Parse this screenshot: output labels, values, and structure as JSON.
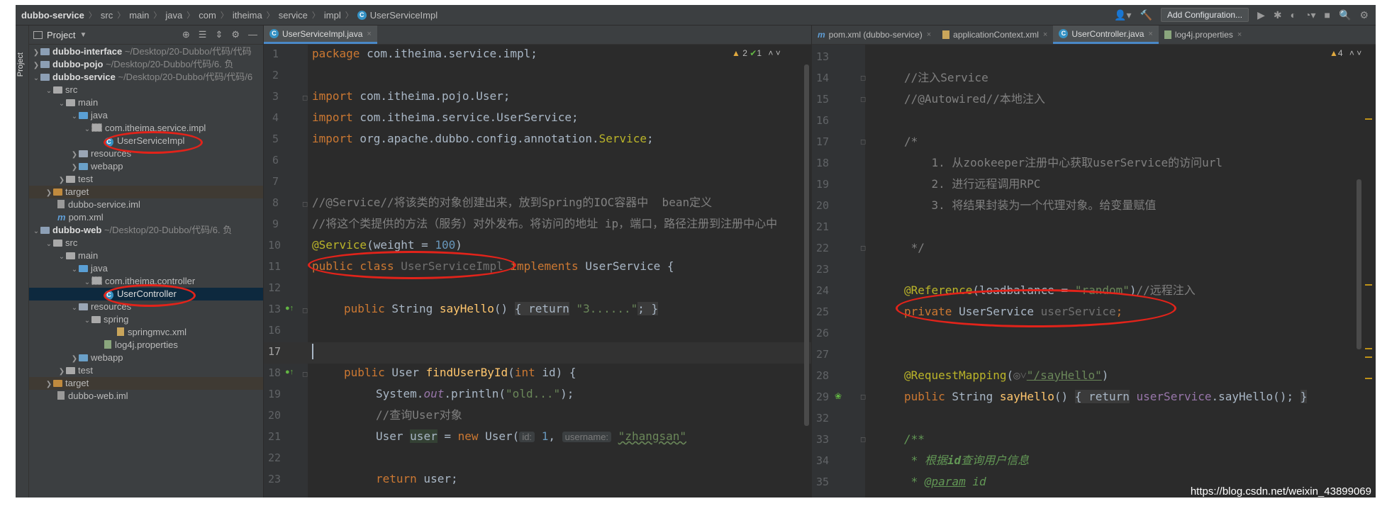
{
  "navbar": {
    "crumbs": [
      "dubbo-service",
      "src",
      "main",
      "java",
      "com",
      "itheima",
      "service",
      "impl"
    ],
    "current_file": "UserServiceImpl",
    "add_config_label": "Add Configuration..."
  },
  "sidebar": {
    "strip_label": "Project"
  },
  "project": {
    "title": "Project",
    "rows": [
      {
        "name": "dubbo-interface",
        "path": " ~/Desktop/20-Dubbo/代码/代码"
      },
      {
        "name": "dubbo-pojo",
        "path": " ~/Desktop/20-Dubbo/代码/6. 负"
      },
      {
        "name": "dubbo-service",
        "path": " ~/Desktop/20-Dubbo/代码/代码/6"
      },
      {
        "name": "src"
      },
      {
        "name": "main"
      },
      {
        "name": "java"
      },
      {
        "name": "com.itheima.service.impl"
      },
      {
        "name": "UserServiceImpl"
      },
      {
        "name": "resources"
      },
      {
        "name": "webapp"
      },
      {
        "name": "test"
      },
      {
        "name": "target"
      },
      {
        "name": "dubbo-service.iml"
      },
      {
        "name": "pom.xml"
      },
      {
        "name": "dubbo-web",
        "path": " ~/Desktop/20-Dubbo/代码/6. 负"
      },
      {
        "name": "src"
      },
      {
        "name": "main"
      },
      {
        "name": "java"
      },
      {
        "name": "com.itheima.controller"
      },
      {
        "name": "UserController"
      },
      {
        "name": "resources"
      },
      {
        "name": "spring"
      },
      {
        "name": "springmvc.xml"
      },
      {
        "name": "log4j.properties"
      },
      {
        "name": "webapp"
      },
      {
        "name": "test"
      },
      {
        "name": "target"
      },
      {
        "name": "dubbo-web.iml"
      }
    ]
  },
  "left_editor": {
    "tab": "UserServiceImpl.java",
    "inspections": {
      "warnings": "2",
      "ok": "1"
    },
    "line_numbers": [
      "1",
      "2",
      "3",
      "4",
      "5",
      "6",
      "7",
      "8",
      "9",
      "10",
      "11",
      "12",
      "13",
      "16",
      "17",
      "18",
      "19",
      "20",
      "21",
      "22",
      "23"
    ],
    "code": {
      "l1_kw": "package",
      "l1_rest": " com.itheima.service.impl;",
      "l3_kw": "import",
      "l3_rest": " com.itheima.pojo.User;",
      "l4_kw": "import",
      "l4_rest": " com.itheima.service.UserService;",
      "l5_kw": "import",
      "l5_rest": " org.apache.dubbo.config.annotation.",
      "l5_ann": "Service",
      "l5_end": ";",
      "l8": "//@Service//将该类的对象创建出来，放到Spring的IOC容器中  bean定义",
      "l9": "//将这个类提供的方法（服务）对外发布。将访问的地址 ip，端口，路径注册到注册中心中",
      "l10_ann": "@Service",
      "l10_a": "(weight = ",
      "l10_num": "100",
      "l10_b": ")",
      "l11_kw": "public class",
      "l11_name": " UserServiceImpl",
      "l11_kw2": " implements",
      "l11_rest": " UserService {",
      "l13_kw": "public",
      "l13_type": " String ",
      "l13_fn": "sayHello",
      "l13_paren": "()",
      "l13_fold": "{ return",
      "l13_str": "\"3......\"",
      "l13_end": "; }",
      "l18_kw": "public",
      "l18_type": " User ",
      "l18_fn": "findUserById",
      "l18_a": "(",
      "l18_kw2": "int",
      "l18_b": " id) {",
      "l19_a": "System.",
      "l19_field": "out",
      "l19_b": ".println(",
      "l19_str": "\"old...\"",
      "l19_c": ");",
      "l20": "//查询User对象",
      "l21_a": "User ",
      "l21_var": "user",
      "l21_b": " = ",
      "l21_kw": "new",
      "l21_c": " User(",
      "l21_h1": "id:",
      "l21_num": "1",
      "l21_d": ",",
      "l21_h2": "username:",
      "l21_str": "\"zhangsan\"",
      "l23_kw": "return",
      "l23_rest": " user;"
    }
  },
  "right_editor": {
    "tabs": [
      "pom.xml (dubbo-service)",
      "applicationContext.xml",
      "UserController.java",
      "log4j.properties"
    ],
    "inspections": {
      "warnings": "4"
    },
    "line_numbers": [
      "13",
      "14",
      "15",
      "16",
      "17",
      "18",
      "19",
      "20",
      "21",
      "22",
      "23",
      "24",
      "25",
      "26",
      "27",
      "28",
      "29",
      "32",
      "33",
      "34",
      "35"
    ],
    "code": {
      "l14": "//注入Service",
      "l15": "//@Autowired//本地注入",
      "l17": "/*",
      "l18": "    1. 从zookeeper注册中心获取userService的访问url",
      "l19": "    2. 进行远程调用RPC",
      "l20": "    3. 将结果封装为一个代理对象。给变量赋值",
      "l22": " */",
      "l24_ann": "@Reference",
      "l24_a": "(loadbalance = ",
      "l24_str": "\"random\"",
      "l24_b": ")",
      "l24_cmt": "//远程注入",
      "l25_kw": "private",
      "l25_type": " UserService ",
      "l25_field": "userService",
      "l25_end": ";",
      "l28_ann": "@RequestMapping",
      "l28_a": "(",
      "l28_icon": "◎˅",
      "l28_str": "\"/sayHello\"",
      "l28_b": ")",
      "l29_kw": "public",
      "l29_type": " String ",
      "l29_fn": "sayHello",
      "l29_paren": "()",
      "l29_fold1": "{ return",
      "l29_field": " userService",
      "l29_rest": ".sayHello();",
      "l29_fold2": "}",
      "l33": "/**",
      "l34_a": " * 根据",
      "l34_i": "id",
      "l34_b": "查询用户信息",
      "l35_a": " * ",
      "l35_tag": "@param",
      "l35_b": " id"
    }
  },
  "watermark": "https://blog.csdn.net/weixin_43899069",
  "colors": {
    "annotation_mark": "#e2231a",
    "selection": "#0d293e"
  }
}
